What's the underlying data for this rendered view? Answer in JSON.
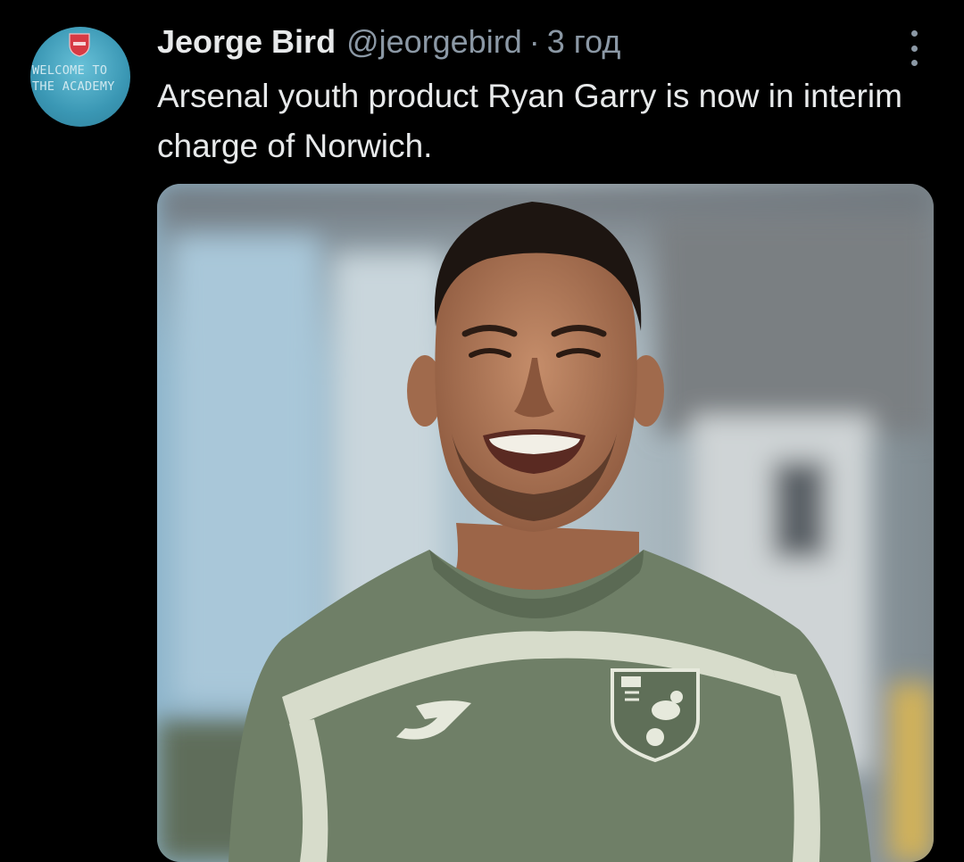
{
  "tweet": {
    "author": {
      "display_name": "Jeorge Bird",
      "handle": "@jeorgebird",
      "separator": "·",
      "timestamp": "3 год",
      "avatar": {
        "sign_line_1": "WELCOME TO",
        "sign_line_2": "THE ACADEMY"
      }
    },
    "text": "Arsenal youth product Ryan Garry is now in interim charge of Norwich.",
    "menu_icon": "more-vertical-icon",
    "media": {
      "kind": "photo",
      "shirt_brand": "joma-logo-icon",
      "badge": "norwich-city-crest-icon"
    }
  },
  "colors": {
    "background": "#000000",
    "primary_text": "#e7e9ea",
    "secondary_text": "#8b98a5",
    "shirt": "#6f7f67",
    "shirt_trim": "#d7dccb"
  }
}
